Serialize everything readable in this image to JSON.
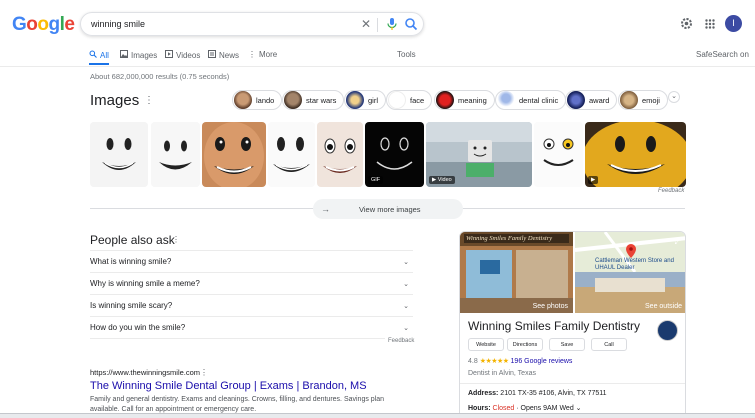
{
  "brand": {
    "letters": [
      "G",
      "o",
      "o",
      "g",
      "l",
      "e"
    ],
    "colors": [
      "#4285F4",
      "#EA4335",
      "#FBBC05",
      "#4285F4",
      "#34A853",
      "#EA4335"
    ]
  },
  "search": {
    "query": "winning smile"
  },
  "user": {
    "initial": "I"
  },
  "tabs": [
    {
      "label": "All",
      "active": true
    },
    {
      "label": "Images"
    },
    {
      "label": "Videos"
    },
    {
      "label": "News"
    },
    {
      "label": "More"
    }
  ],
  "tools_label": "Tools",
  "safesearch_label": "SafeSearch on",
  "stats": "About 682,000,000 results (0.75 seconds)",
  "images": {
    "title": "Images",
    "chips": [
      "lando",
      "star wars",
      "girl",
      "face",
      "meaning",
      "dental clinic",
      "award",
      "emoji"
    ],
    "badges": {
      "gif": "GIF",
      "video": "Video"
    },
    "feedback": "Feedback",
    "view_more": "View more images"
  },
  "paa": {
    "title": "People also ask",
    "questions": [
      "What is winning smile?",
      "Why is winning smile a meme?",
      "Is winning smile scary?",
      "How do you win the smile?"
    ],
    "feedback": "Feedback"
  },
  "result": {
    "url": "https://www.thewinningsmile.com",
    "title": "The Winning Smile Dental Group | Exams | Brandon, MS",
    "snippet": "Family and general dentistry. Exams and cleanings. Crowns, filling, and dentures. Savings plan available. Call for an appointment or emergency care."
  },
  "knowledge_panel": {
    "photos_label": "See photos",
    "outside_label": "See outside",
    "map_label": "Cattleman Western Store and UHAUL Dealer",
    "title": "Winning Smiles Family Dentistry",
    "buttons": [
      "Website",
      "Directions",
      "Save",
      "Call"
    ],
    "rating": "4.8",
    "stars": "★★★★★",
    "reviews": "196 Google reviews",
    "type": "Dentist in Alvin, Texas",
    "address_label": "Address:",
    "address": "2101 TX-35 #106, Alvin, TX 77511",
    "hours_label": "Hours:",
    "hours_status": "Closed",
    "hours_open": "· Opens 9AM Wed",
    "status_color": "#d93025"
  }
}
